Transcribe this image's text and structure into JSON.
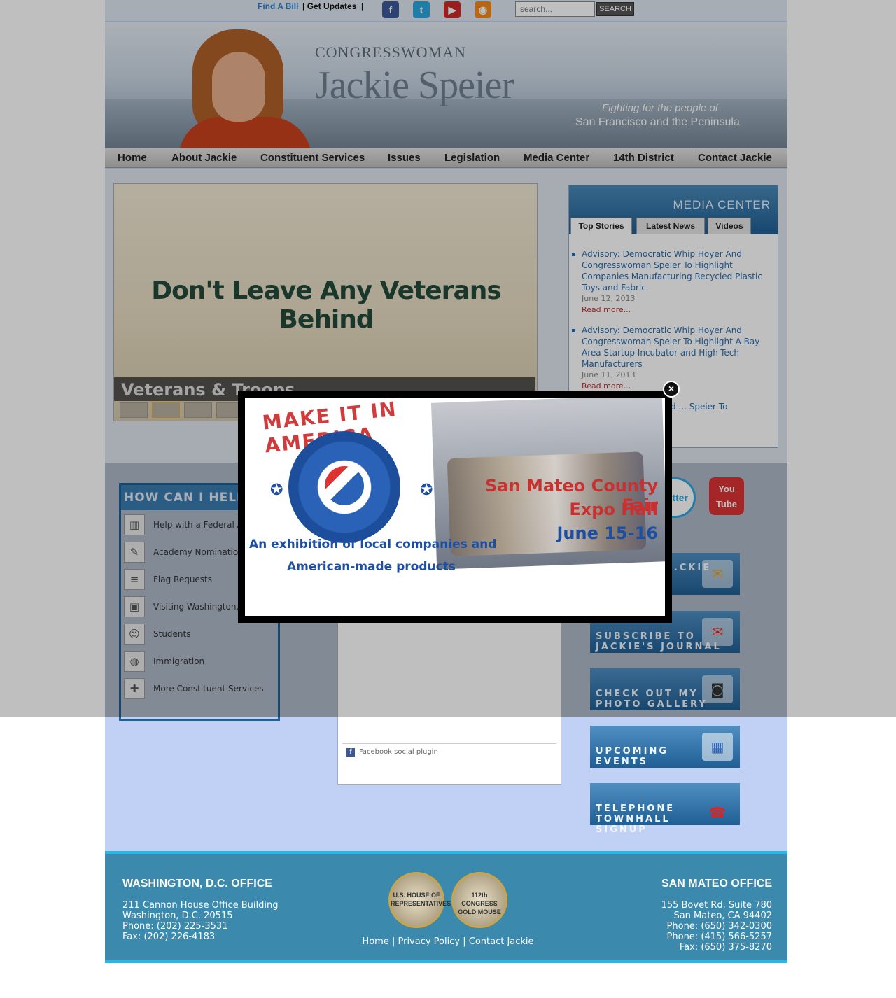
{
  "topbar": {
    "find_a_bill": "Find A Bill",
    "get_updates": "| Get Updates",
    "sep": "|",
    "search_placeholder": "search...",
    "search_button": "SEARCH",
    "social_icons": [
      "facebook-icon",
      "twitter-icon",
      "youtube-icon",
      "rss-icon"
    ]
  },
  "banner": {
    "congresswoman": "CONGRESSWOMAN",
    "name": "Jackie Speier",
    "tagline_1": "Fighting for the people of",
    "tagline_2": "San Francisco and the Peninsula"
  },
  "nav": {
    "items": [
      "Home",
      "About Jackie",
      "Constituent Services",
      "Issues",
      "Legislation",
      "Media Center",
      "14th District",
      "Contact Jackie"
    ]
  },
  "slider": {
    "headline": "Don't Leave Any Veterans Behind",
    "caption": "Veterans & Troops"
  },
  "media_center": {
    "title": "MEDIA CENTER",
    "tabs": [
      "Top Stories",
      "Latest News",
      "Videos"
    ],
    "stories": [
      {
        "title": "Advisory: Democratic Whip Hoyer And Congresswoman Speier To Highlight Companies Manufacturing Recycled Plastic Toys and Fabric",
        "date": "June 12, 2013",
        "more": "Read more..."
      },
      {
        "title": "Advisory: Democratic Whip Hoyer And Congresswoman Speier To Highlight A Bay Area Startup Incubator and High-Tech Manufacturers",
        "date": "June 11, 2013",
        "more": "Read more..."
      },
      {
        "title": "Whip Steny Hoyer and ... Speier To Highlight ...ing",
        "date": "",
        "more": ""
      }
    ]
  },
  "help": {
    "title": "HOW CAN I HELP",
    "items": [
      "Help with a Federal A...",
      "Academy Nomination...",
      "Flag Requests",
      "Visiting Washington,",
      "Students",
      "Immigration",
      "More Constituent Services"
    ]
  },
  "facebook": {
    "plugin_label": "Facebook social plugin"
  },
  "side_buttons": {
    "twitter": "twitter",
    "youtube": "You Tube",
    "email": "...CKIE",
    "subscribe": "SUBSCRIBE TO\nJACKIE'S JOURNAL",
    "photo": "CHECK OUT MY\nPHOTO GALLERY",
    "events": "UPCOMING\nEVENTS",
    "townhall": "TELEPHONE TOWNHALL\nSIGNUP"
  },
  "modal": {
    "arc_text": "MAKE IT IN AMERICA",
    "fair_line_1": "San Mateo County Fair",
    "fair_line_2": "Expo Hall",
    "fair_line_3": "June 15-16",
    "exhibition_1": "An exhibition of local companies and",
    "exhibition_2": "American-made products"
  },
  "footer": {
    "dc_title": "WASHINGTON, D.C. OFFICE",
    "dc_lines": [
      "211 Cannon House Office Building",
      "Washington, D.C. 20515",
      "Phone: (202) 225-3531",
      "Fax: (202) 226-4183"
    ],
    "sm_title": "SAN MATEO OFFICE",
    "sm_lines": [
      "155 Bovet Rd, Suite 780",
      "San Mateo, CA 94402",
      "Phone: (650) 342-0300",
      "Phone: (415) 566-5257",
      "Fax: (650) 375-8270"
    ],
    "seal_1": "U.S. HOUSE OF REPRESENTATIVES",
    "seal_2": "112th CONGRESS GOLD MOUSE",
    "links": [
      "Home",
      "Privacy Policy",
      "Contact Jackie"
    ]
  },
  "colors": {
    "accent": "#1f5f94",
    "footer": "#3b8aad",
    "footer_rule": "#27b6e8",
    "page_bg": "#c1d1f5"
  }
}
